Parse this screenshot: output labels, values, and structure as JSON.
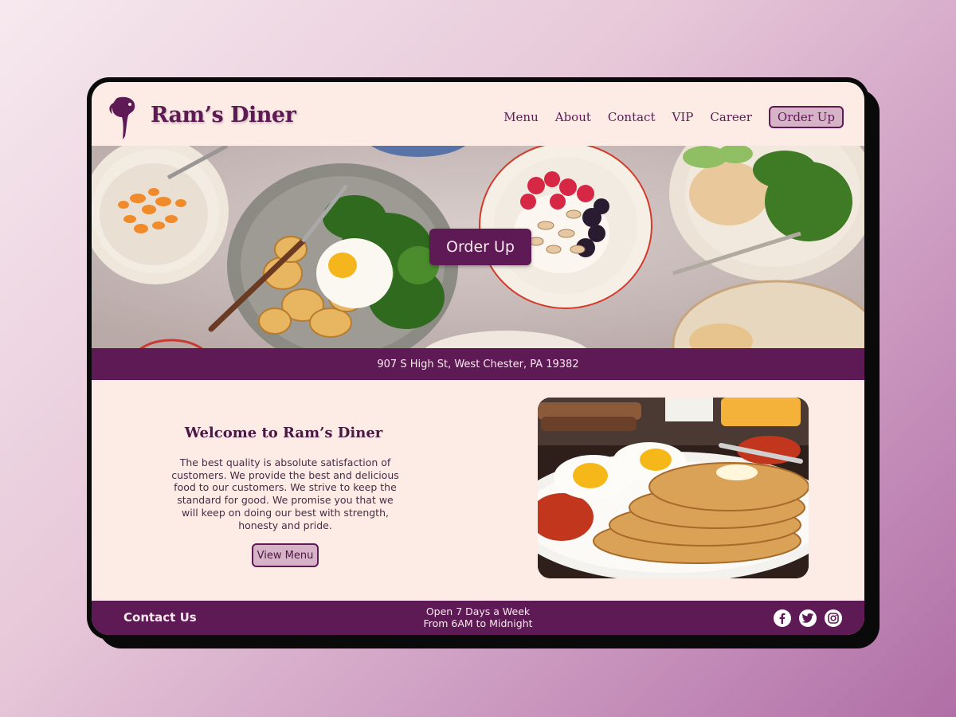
{
  "brand": {
    "name": "Ram’s Diner"
  },
  "nav": {
    "items": [
      "Menu",
      "About",
      "Contact",
      "VIP",
      "Career"
    ],
    "order_label": "Order Up"
  },
  "hero": {
    "cta_label": "Order Up"
  },
  "address": "907 S High St, West Chester, PA 19382",
  "welcome": {
    "title": "Welcome to Ram’s Diner",
    "body": "The best quality is absolute satisfaction of customers. We provide the best and delicious food to our customers. We strive to keep the standard for good. We promise you that we will keep on doing our best with strength, honesty and pride.",
    "button_label": "View Menu"
  },
  "footer": {
    "contact_label": "Contact Us",
    "hours_line1": "Open 7 Days a Week",
    "hours_line2": "From 6AM to Midnight",
    "social": [
      "facebook-icon",
      "twitter-icon",
      "instagram-icon"
    ]
  },
  "colors": {
    "brand_purple": "#5e1a54",
    "background": "#fdebe6",
    "button_tint": "#d7b3c8"
  }
}
